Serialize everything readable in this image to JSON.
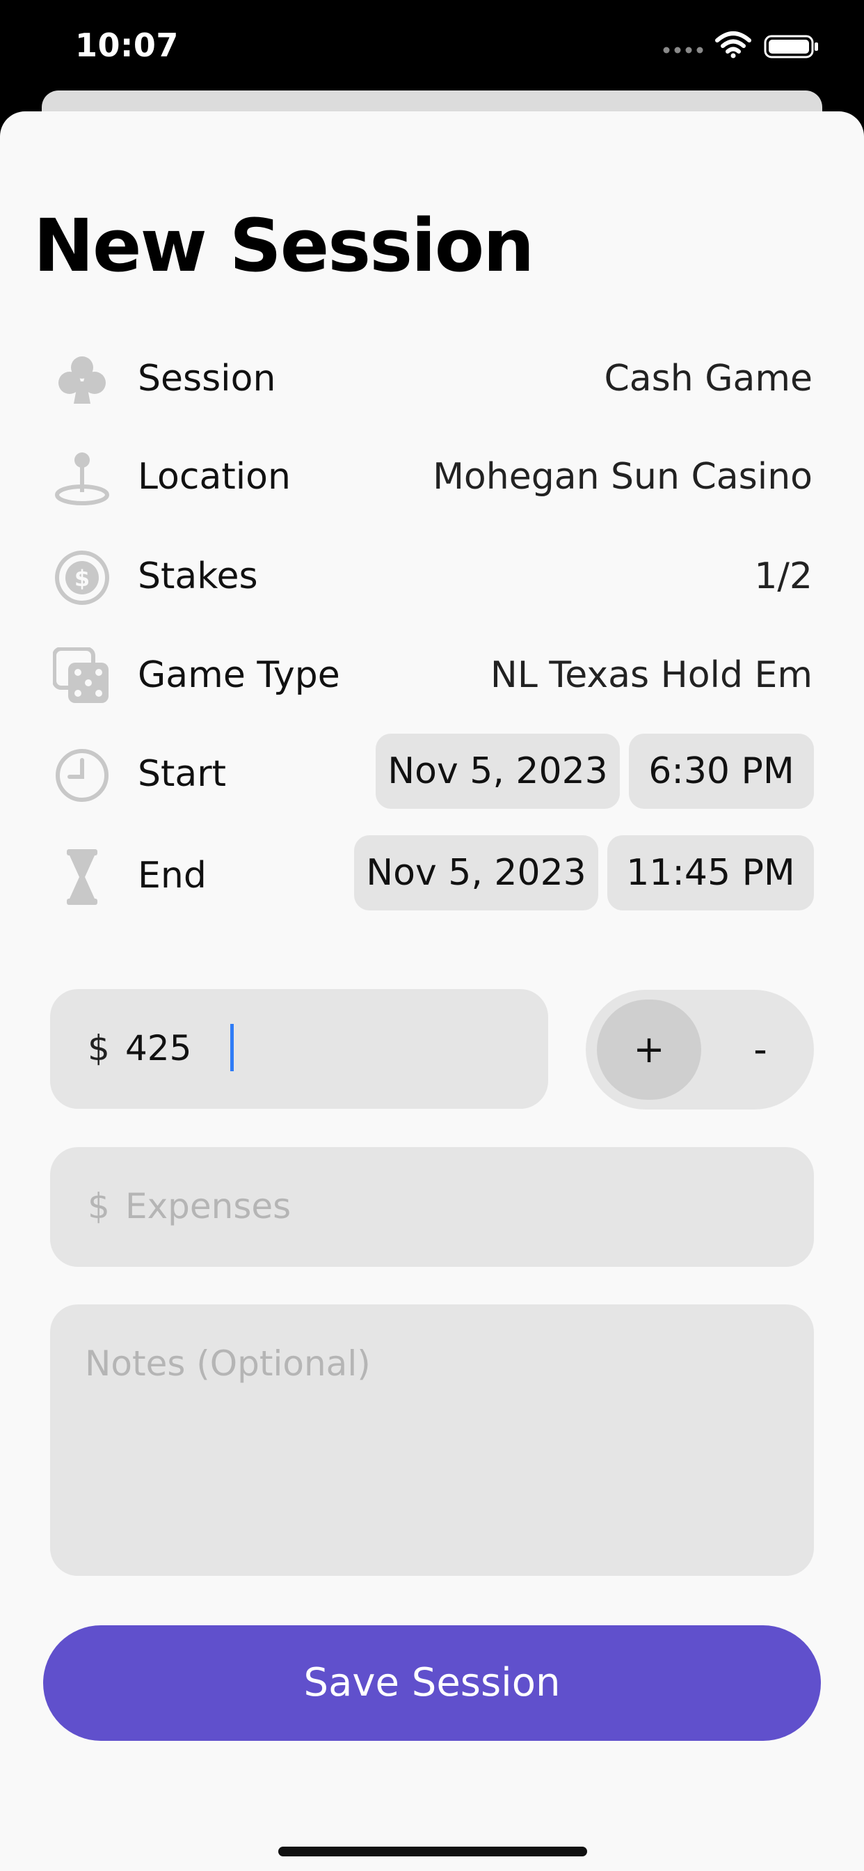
{
  "status_bar": {
    "time": "10:07",
    "icons": [
      "signal-dots-icon",
      "wifi-icon",
      "battery-icon"
    ]
  },
  "page": {
    "title": "New Session"
  },
  "fields": {
    "session": {
      "icon": "club-icon",
      "label": "Session",
      "value": "Cash Game"
    },
    "location": {
      "icon": "map-pin-icon",
      "label": "Location",
      "value": "Mohegan Sun Casino"
    },
    "stakes": {
      "icon": "dollar-circle-icon",
      "label": "Stakes",
      "value": "1/2"
    },
    "game_type": {
      "icon": "dice-icon",
      "label": "Game Type",
      "value": "NL Texas Hold Em"
    },
    "start": {
      "icon": "clock-icon",
      "label": "Start",
      "date": "Nov 5, 2023",
      "time": "6:30 PM"
    },
    "end": {
      "icon": "hourglass-icon",
      "label": "End",
      "date": "Nov 5, 2023",
      "time": "11:45 PM"
    }
  },
  "amount": {
    "currency": "$",
    "value": "425",
    "plus_label": "+",
    "minus_label": "-"
  },
  "expenses": {
    "currency": "$",
    "placeholder": "Expenses"
  },
  "notes": {
    "placeholder": "Notes (Optional)"
  },
  "save_button": {
    "label": "Save Session"
  },
  "colors": {
    "accent": "#6050cc",
    "caret": "#2f7cf6",
    "field_bg": "#e5e5e5",
    "icon_gray": "#c8c8c8"
  }
}
